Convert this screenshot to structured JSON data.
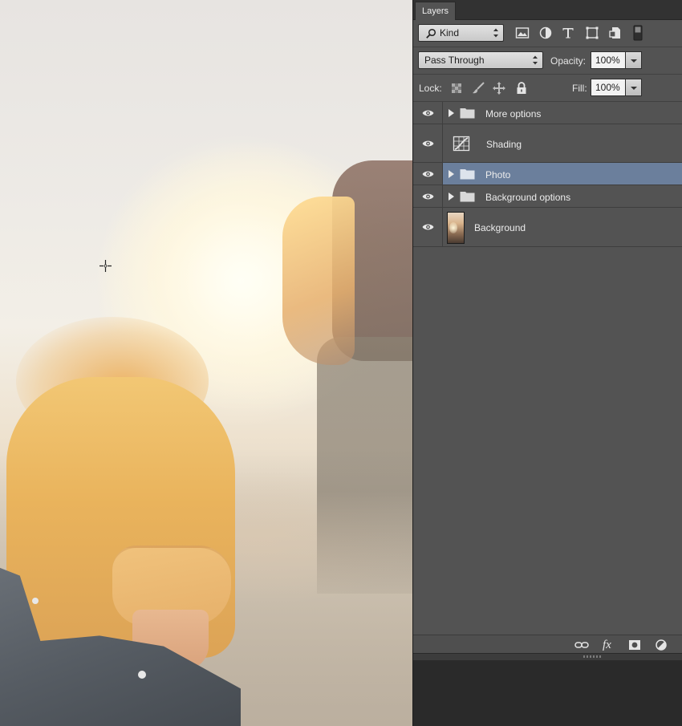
{
  "panel": {
    "tab_label": "Layers",
    "filter": {
      "kind_label": "Kind"
    },
    "blend_mode": "Pass Through",
    "opacity_label": "Opacity:",
    "opacity_value": "100%",
    "lock_label": "Lock:",
    "fill_label": "Fill:",
    "fill_value": "100%"
  },
  "layers": [
    {
      "name": "More options",
      "type": "group",
      "visible": true,
      "selected": false
    },
    {
      "name": "Shading",
      "type": "adjustment",
      "visible": true,
      "selected": false
    },
    {
      "name": "Photo",
      "type": "group",
      "visible": true,
      "selected": true
    },
    {
      "name": "Background options",
      "type": "group",
      "visible": true,
      "selected": false
    },
    {
      "name": "Background",
      "type": "image",
      "visible": true,
      "selected": false
    }
  ],
  "bottom_bar": {
    "fx_label": "fx"
  },
  "colors": {
    "panel_bg": "#535353",
    "selected_row": "#6b7f9c",
    "dark_bg": "#2b2b2b"
  },
  "icons": [
    "search-icon",
    "image-filter-icon",
    "adjustment-filter-icon",
    "type-filter-icon",
    "shape-filter-icon",
    "smart-object-filter-icon",
    "filter-toggle-icon",
    "lock-transparent-icon",
    "lock-paint-icon",
    "lock-position-icon",
    "lock-all-icon",
    "eye-icon",
    "folder-icon",
    "link-icon",
    "fx-icon",
    "mask-icon",
    "adjustment-icon"
  ]
}
